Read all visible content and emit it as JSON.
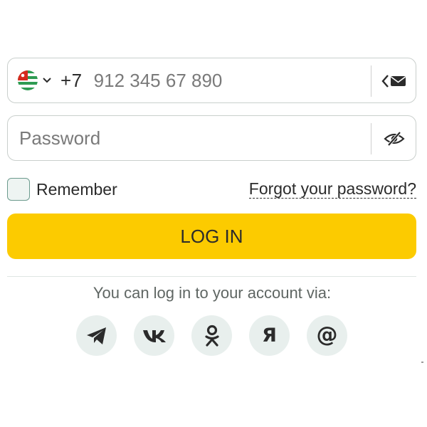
{
  "phone": {
    "prefix": "+7",
    "placeholder": "912 345 67 890",
    "flag_icon": "abkhazia-flag-icon",
    "switch_icon": "switch-to-email-icon"
  },
  "password": {
    "placeholder": "Password",
    "toggle_icon": "eye-off-icon"
  },
  "remember": {
    "label": "Remember",
    "checked": false
  },
  "forgot": {
    "label": "Forgot your password?"
  },
  "login": {
    "label": "LOG IN"
  },
  "social": {
    "heading": "You can log in to your account via:",
    "providers": [
      {
        "name": "Telegram",
        "icon": "telegram-icon"
      },
      {
        "name": "VK",
        "icon": "vk-icon"
      },
      {
        "name": "Odnoklassniki",
        "icon": "odnoklassniki-icon"
      },
      {
        "name": "Yandex",
        "icon": "yandex-icon",
        "glyph": "Я"
      },
      {
        "name": "Mail",
        "icon": "mail-at-icon",
        "glyph": "@"
      }
    ]
  },
  "colors": {
    "accent": "#fccb00",
    "border": "#c9cfcc",
    "social_bg": "#e8efed",
    "checkbox_border": "#6b9a8d",
    "text": "#2b2b2b"
  }
}
